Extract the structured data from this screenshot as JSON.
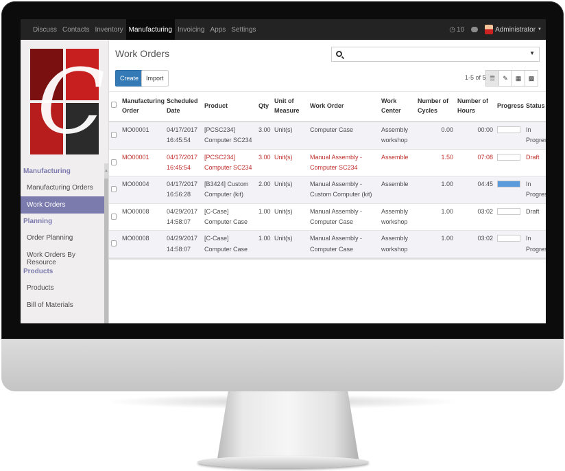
{
  "topbar": {
    "menu": [
      "Discuss",
      "Contacts",
      "Inventory",
      "Manufacturing",
      "Invoicing",
      "Apps",
      "Settings"
    ],
    "active_menu": "Manufacturing",
    "activity_count": "10",
    "user": "Administrator"
  },
  "sidebar": {
    "sections": [
      {
        "title": "Manufacturing",
        "items": [
          "Manufacturing Orders",
          "Work Orders"
        ]
      },
      {
        "title": "Planning",
        "items": [
          "Order Planning",
          "Work Orders By Resource"
        ]
      },
      {
        "title": "Products",
        "items": [
          "Products",
          "Bill of Materials"
        ]
      }
    ],
    "active_item": "Work Orders"
  },
  "control_panel": {
    "title": "Work Orders",
    "search_value": "",
    "create_label": "Create",
    "import_label": "Import",
    "pager": "1-5 of 5"
  },
  "table": {
    "columns": [
      "Manufacturing Order",
      "Scheduled Date",
      "Product",
      "Qty",
      "Unit of Measure",
      "Work Order",
      "Work Center",
      "Number of Cycles",
      "Number of Hours",
      "Progress",
      "Status"
    ],
    "rows": [
      {
        "mo": "MO00001",
        "date": "04/17/2017 16:45:54",
        "product": "[PCSC234] Computer SC234",
        "qty": "3.00",
        "uom": "Unit(s)",
        "work_order": "Computer Case",
        "work_center": "Assembly workshop",
        "cycles": "0.00",
        "hours": "00:00",
        "progress": 0,
        "status": "In Progress",
        "draft": false
      },
      {
        "mo": "MO00001",
        "date": "04/17/2017 16:45:54",
        "product": "[PCSC234] Computer SC234",
        "qty": "3.00",
        "uom": "Unit(s)",
        "work_order": "Manual Assembly - Computer SC234",
        "work_center": "Assemble",
        "cycles": "1.50",
        "hours": "07:08",
        "progress": 0,
        "status": "Draft",
        "draft": true
      },
      {
        "mo": "MO00004",
        "date": "04/17/2017 16:56:28",
        "product": "[B3424] Custom Computer (kit)",
        "qty": "2.00",
        "uom": "Unit(s)",
        "work_order": "Manual Assembly - Custom Computer (kit)",
        "work_center": "Assemble",
        "cycles": "1.00",
        "hours": "04:45",
        "progress": 100,
        "status": "In Progress",
        "draft": false
      },
      {
        "mo": "MO00008",
        "date": "04/29/2017 14:58:07",
        "product": "[C-Case] Computer Case",
        "qty": "1.00",
        "uom": "Unit(s)",
        "work_order": "Manual Assembly - Computer Case",
        "work_center": "Assembly workshop",
        "cycles": "1.00",
        "hours": "03:02",
        "progress": 0,
        "status": "Draft",
        "draft": false
      },
      {
        "mo": "MO00008",
        "date": "04/29/2017 14:58:07",
        "product": "[C-Case] Computer Case",
        "qty": "1.00",
        "uom": "Unit(s)",
        "work_order": "Manual Assembly - Computer Case",
        "work_center": "Assembly workshop",
        "cycles": "1.00",
        "hours": "03:02",
        "progress": 0,
        "status": "In Progress",
        "draft": false
      }
    ]
  },
  "colors": {
    "accent": "#7c7bad",
    "primary_button": "#337ab7",
    "draft_text": "#c0302c",
    "progress_fill": "#5b9bdc"
  }
}
